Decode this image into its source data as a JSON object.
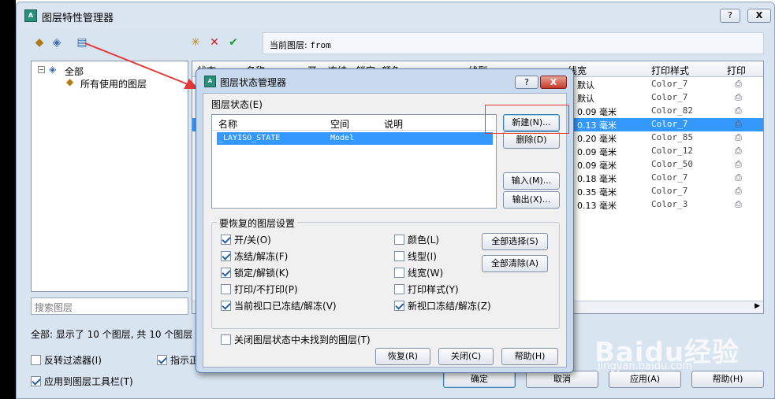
{
  "main_window": {
    "title": "图层特性管理器",
    "help_label": "?",
    "close_label": "X",
    "current_layer_label": "当前图层:",
    "current_layer_value": "from",
    "tree": {
      "root": "全部",
      "child": "所有使用的图层"
    },
    "search_placeholder": "搜索图层",
    "grid_headers": [
      "状态",
      "名称",
      "开",
      "冻结",
      "锁定",
      "颜色",
      "线型",
      "线宽",
      "打印样式",
      "打印"
    ],
    "rows": [
      {
        "lineweight": "默认",
        "plotstyle": "Color_7",
        "selected": false
      },
      {
        "lineweight": "默认",
        "plotstyle": "Color_7",
        "selected": false
      },
      {
        "lineweight": "0.09 毫米",
        "plotstyle": "Color_82",
        "selected": false
      },
      {
        "lineweight": "0.13 毫米",
        "plotstyle": "Color_7",
        "selected": true
      },
      {
        "lineweight": "0.20 毫米",
        "plotstyle": "Color_85",
        "selected": false
      },
      {
        "lineweight": "0.09 毫米",
        "plotstyle": "Color_12",
        "selected": false
      },
      {
        "lineweight": "0.09 毫米",
        "plotstyle": "Color_50",
        "selected": false
      },
      {
        "lineweight": "0.18 毫米",
        "plotstyle": "Color_7",
        "selected": false
      },
      {
        "lineweight": "0.35 毫米",
        "plotstyle": "Color_7",
        "selected": false
      },
      {
        "lineweight": "0.13 毫米",
        "plotstyle": "Color_3",
        "selected": false
      }
    ],
    "status_text": "全部: 显示了 10 个图层, 共 10 个图层",
    "invert_filter": "反转过滤器(I)",
    "indicate_label": "指示正",
    "apply_toolbar": "应用到图层工具栏(T)",
    "ok": "确定",
    "cancel": "取消",
    "apply": "应用(A)",
    "help": "帮助(H)"
  },
  "dialog": {
    "title": "图层状态管理器",
    "help_label": "?",
    "close_label": "X",
    "states_label": "图层状态(E)",
    "columns": [
      "名称",
      "空间",
      "说明"
    ],
    "state_row": {
      "name": "_LAYISO_STATE",
      "space": "Model",
      "desc": ""
    },
    "new": "新建(N)...",
    "delete": "删除(D)",
    "import": "输入(M)...",
    "export": "输出(X)...",
    "restore_group": "要恢复的图层设置",
    "options": [
      {
        "label": "开/关(O)",
        "checked": true
      },
      {
        "label": "冻结/解冻(F)",
        "checked": true
      },
      {
        "label": "锁定/解锁(K)",
        "checked": true
      },
      {
        "label": "打印/不打印(P)",
        "checked": false
      },
      {
        "label": "当前视口已冻结/解冻(V)",
        "checked": true
      },
      {
        "label": "颜色(L)",
        "checked": false
      },
      {
        "label": "线型(I)",
        "checked": false
      },
      {
        "label": "线宽(W)",
        "checked": false
      },
      {
        "label": "打印样式(Y)",
        "checked": false
      },
      {
        "label": "新视口冻结/解冻(Z)",
        "checked": true
      }
    ],
    "select_all": "全部选择(S)",
    "clear_all": "全部清除(A)",
    "close_not_found": "关闭图层状态中未找到的图层(T)",
    "restore": "恢复(R)",
    "close": "关闭(C)",
    "help": "帮助(H)"
  },
  "watermark": {
    "text": "Baidu经验",
    "sub": "jingyan.baidu.com"
  },
  "colors": {
    "selection": "#3399ff",
    "annotation_red": "#e23a3a"
  }
}
